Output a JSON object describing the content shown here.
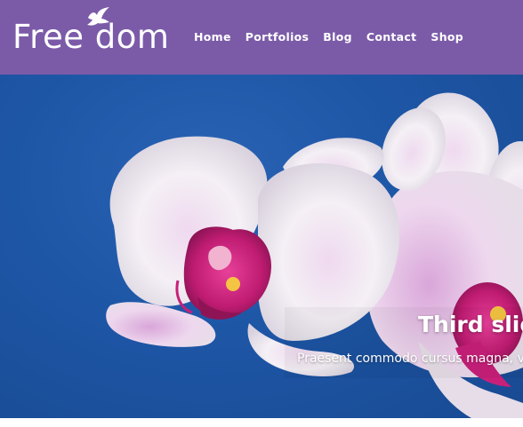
{
  "logo": {
    "text": "Free dom",
    "icon": "dove-icon"
  },
  "nav": {
    "items": [
      {
        "label": "Home"
      },
      {
        "label": "Portfolios"
      },
      {
        "label": "Blog"
      },
      {
        "label": "Contact"
      },
      {
        "label": "Shop"
      }
    ]
  },
  "slider": {
    "title": "Third slid",
    "caption": "Praesent commodo cursus magna, v",
    "image": "orchid-photo"
  },
  "colors": {
    "header_bg": "#7b5ba8",
    "sky": "#1e56a6",
    "text": "#ffffff"
  }
}
